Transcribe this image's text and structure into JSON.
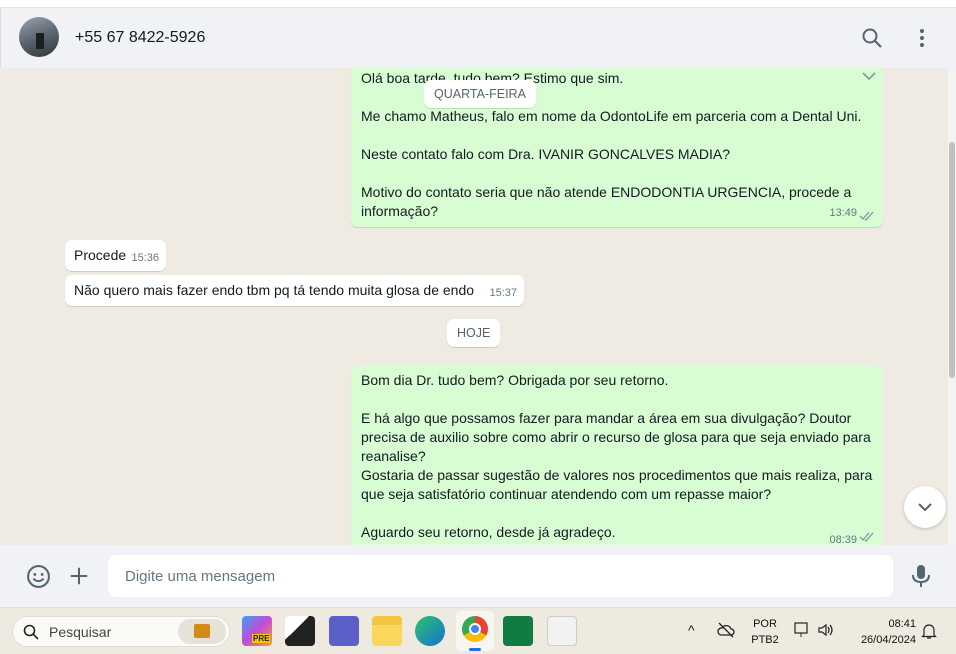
{
  "header": {
    "contact_name": "+55 67 8422-5926",
    "search_icon": "search-icon",
    "menu_icon": "menu-dots-icon"
  },
  "chat": {
    "messages": [
      {
        "direction": "out",
        "text": "Olá boa tarde, tudo bem? Estimo que sim.\n\nMe chamo Matheus, falo em nome da OdontoLife em parceria com a Dental Uni.\n\nNeste contato falo com Dra. IVANIR GONCALVES MADIA?\n\nMotivo do contato seria que não atende ENDODONTIA URGENCIA, procede a informação?",
        "time": "13:49"
      },
      {
        "direction": "in",
        "text": "Procede",
        "time": "15:36"
      },
      {
        "direction": "in",
        "text": "Não quero mais fazer endo tbm pq tá tendo muita glosa de endo",
        "time": "15:37"
      },
      {
        "direction": "out",
        "text": "Bom dia Dr. tudo bem? Obrigada por seu retorno.\n\nE há algo que possamos fazer para mandar a área em sua divulgação? Doutor precisa de auxilio sobre como abrir o recurso de glosa para que seja enviado para reanalise?\nGostaria de passar sugestão de valores nos procedimentos que mais realiza, para que seja satisfatório continuar atendendo com um repasse maior?\n\nAguardo seu retorno, desde já agradeço.",
        "time": "08:39"
      }
    ],
    "date_chips": [
      "QUARTA-FEIRA",
      "HOJE"
    ]
  },
  "composer": {
    "placeholder": "Digite uma mensagem"
  },
  "taskbar": {
    "search_label": "Pesquisar",
    "lang_top": "POR",
    "lang_bottom": "PTB2",
    "time": "08:41",
    "date": "26/04/2024",
    "copilot_badge": "PRE"
  }
}
